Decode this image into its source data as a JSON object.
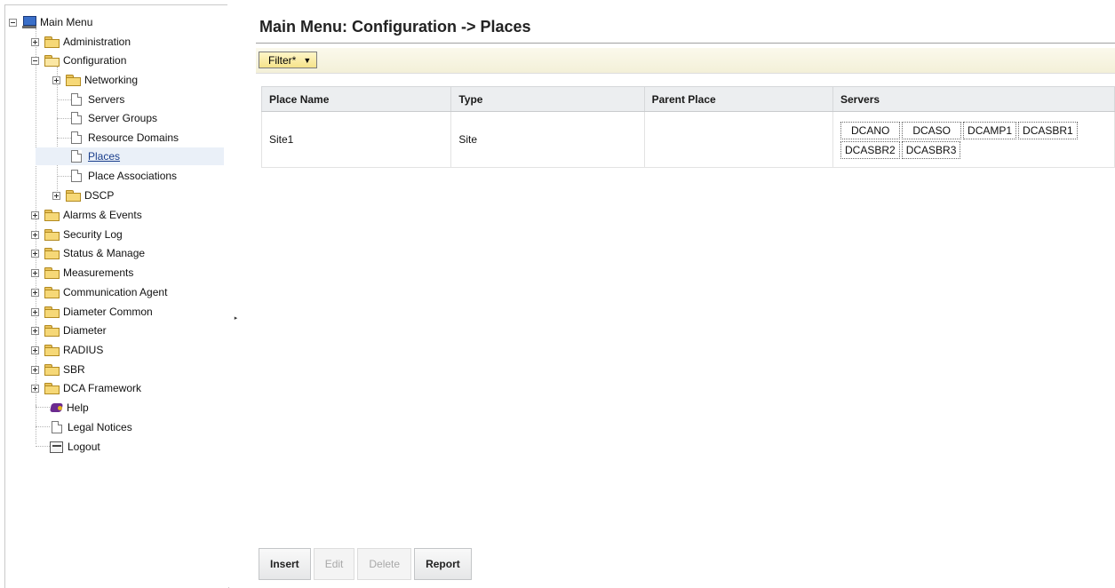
{
  "tree": {
    "root": "Main Menu",
    "items": [
      {
        "label": "Administration"
      },
      {
        "label": "Configuration"
      },
      {
        "label": "Networking"
      },
      {
        "label": "Servers"
      },
      {
        "label": "Server Groups"
      },
      {
        "label": "Resource Domains"
      },
      {
        "label": "Places"
      },
      {
        "label": "Place Associations"
      },
      {
        "label": "DSCP"
      },
      {
        "label": "Alarms & Events"
      },
      {
        "label": "Security Log"
      },
      {
        "label": "Status & Manage"
      },
      {
        "label": "Measurements"
      },
      {
        "label": "Communication Agent"
      },
      {
        "label": "Diameter Common"
      },
      {
        "label": "Diameter"
      },
      {
        "label": "RADIUS"
      },
      {
        "label": "SBR"
      },
      {
        "label": "DCA Framework"
      },
      {
        "label": "Help"
      },
      {
        "label": "Legal Notices"
      },
      {
        "label": "Logout"
      }
    ]
  },
  "main": {
    "title": "Main Menu: Configuration -> Places",
    "filter_label": "Filter*"
  },
  "table": {
    "headers": [
      "Place Name",
      "Type",
      "Parent Place",
      "Servers"
    ],
    "rows": [
      {
        "place_name": "Site1",
        "type": "Site",
        "parent_place": "",
        "servers": [
          "DCANO",
          "DCASO",
          "DCAMP1",
          "DCASBR1",
          "DCASBR2",
          "DCASBR3"
        ]
      }
    ]
  },
  "actions": {
    "insert": "Insert",
    "edit": "Edit",
    "delete": "Delete",
    "report": "Report"
  }
}
